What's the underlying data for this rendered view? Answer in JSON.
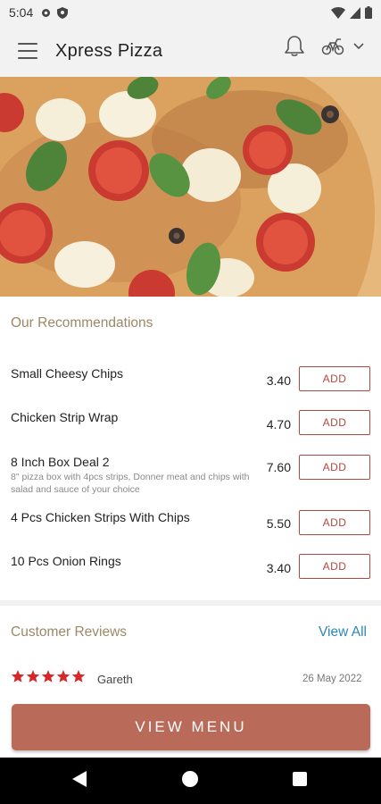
{
  "status_bar": {
    "time": "5:04"
  },
  "app_bar": {
    "title": "Xpress Pizza"
  },
  "recommendations": {
    "title": "Our Recommendations",
    "add_label": "ADD",
    "items": [
      {
        "name": "Small Cheesy Chips",
        "price": "3.40",
        "description": ""
      },
      {
        "name": "Chicken Strip Wrap",
        "price": "4.70",
        "description": ""
      },
      {
        "name": "8 Inch Box Deal 2",
        "price": "7.60",
        "description": "8\" pizza box with 4pcs strips, Donner meat and chips with salad and sauce of your choice"
      },
      {
        "name": "4 Pcs Chicken Strips With Chips",
        "price": "5.50",
        "description": ""
      },
      {
        "name": "10 Pcs Onion Rings",
        "price": "3.40",
        "description": ""
      }
    ]
  },
  "reviews": {
    "title": "Customer Reviews",
    "view_all": "View All",
    "items": [
      {
        "rating": 5,
        "name": "Gareth",
        "date": "26 May 2022"
      }
    ]
  },
  "footer": {
    "view_menu": "VIEW MENU"
  },
  "colors": {
    "accent": "#b96a58",
    "add_border": "#b04a3f",
    "section_title": "#9c8866",
    "link": "#2f86b9",
    "star": "#d62828"
  },
  "icons": {
    "menu": "hamburger-icon",
    "bell": "bell-icon",
    "delivery": "bike-icon",
    "dropdown": "chevron-down-icon",
    "star": "star-icon",
    "back": "back-icon",
    "home": "home-icon",
    "recents": "recents-icon"
  }
}
